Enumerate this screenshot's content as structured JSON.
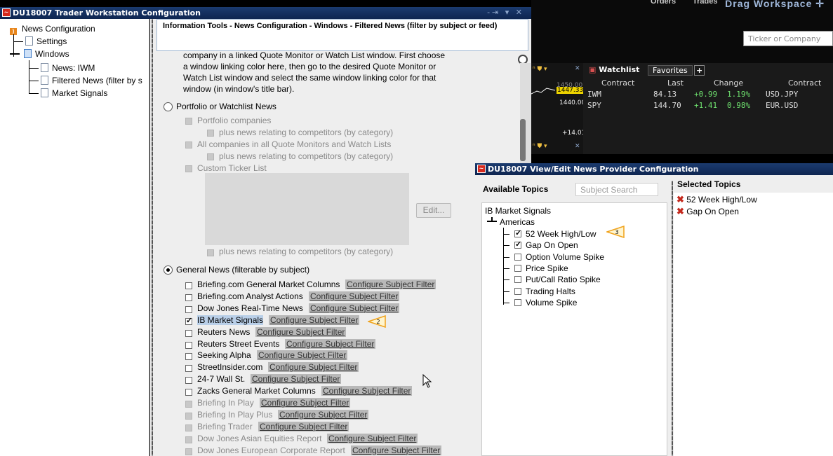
{
  "workspace": {
    "tabs": [
      "Orders",
      "Trades"
    ],
    "drag_label": "Drag Workspace",
    "ticker_placeholder": "Ticker or Company"
  },
  "config_window": {
    "title": "DU18007 Trader Workstation Configuration",
    "controls": "-⇥ ▾  ✕",
    "tree": {
      "root": "News Configuration",
      "settings": "Settings",
      "windows": "Windows",
      "items": [
        "News: IWM",
        "Filtered News (filter by s",
        "Market Signals"
      ]
    },
    "info_header": "Information Tools - News Configuration - Windows - Filtered News (filter by subject or feed)",
    "intro_lines": [
      "company in a linked Quote Monitor or Watch List window. First choose",
      "a window linking color here, then go to the desired Quote Monitor or",
      "Watch List window and select the same window linking color for that",
      "window (in window's title bar)."
    ],
    "portfolio_radio": "Portfolio or Watchlist News",
    "portfolio_opts": [
      "Portfolio companies",
      "plus news relating to competitors (by category)",
      "All companies in all Quote Monitors and Watch Lists",
      "plus news relating to competitors (by category)",
      "Custom Ticker List"
    ],
    "edit_button": "Edit...",
    "custom_competitors": "plus news relating to competitors (by category)",
    "general_radio": "General News (filterable by subject)",
    "configure_link": "Configure Subject Filter",
    "sources": [
      {
        "name": "Briefing.com General Market Columns",
        "checked": false,
        "enabled": true
      },
      {
        "name": "Briefing.com Analyst Actions",
        "checked": false,
        "enabled": true
      },
      {
        "name": "Dow Jones Real-Time News",
        "checked": false,
        "enabled": true
      },
      {
        "name": "IB Market Signals",
        "checked": true,
        "enabled": true
      },
      {
        "name": "Reuters News",
        "checked": false,
        "enabled": true
      },
      {
        "name": "Reuters Street Events",
        "checked": false,
        "enabled": true
      },
      {
        "name": "Seeking Alpha",
        "checked": false,
        "enabled": true
      },
      {
        "name": "StreetInsider.com",
        "checked": false,
        "enabled": true
      },
      {
        "name": "24-7 Wall St.",
        "checked": false,
        "enabled": true
      },
      {
        "name": "Zacks General Market Columns",
        "checked": false,
        "enabled": true
      },
      {
        "name": "Briefing In Play",
        "checked": false,
        "enabled": false
      },
      {
        "name": "Briefing In Play Plus",
        "checked": false,
        "enabled": false
      },
      {
        "name": "Briefing Trader",
        "checked": false,
        "enabled": false
      },
      {
        "name": "Dow Jones Asian Equities Report",
        "checked": false,
        "enabled": false
      },
      {
        "name": "Dow Jones European Corporate Report",
        "checked": false,
        "enabled": false
      }
    ],
    "callouts": [
      "1",
      "2",
      "3"
    ]
  },
  "mini_chart": {
    "price_high": "1447.33",
    "price_top": "1450.00",
    "price_mid": "1440.00",
    "change": "+14.01"
  },
  "watchlist": {
    "title": "Watchlist",
    "tab": "Favorites",
    "add_tab": "+",
    "columns": [
      "Contract",
      "Last",
      "Change",
      "Contract"
    ],
    "rows": [
      {
        "contract": "IWM",
        "last": "84.13",
        "change": "+0.99",
        "pct": "1.19%",
        "fx": "USD.JPY"
      },
      {
        "contract": "SPY",
        "last": "144.70",
        "change": "+1.41",
        "pct": "0.98%",
        "fx": "EUR.USD"
      }
    ]
  },
  "news_provider": {
    "title": "DU18007 View/Edit News Provider Configuration",
    "available_label": "Available Topics",
    "search_placeholder": "Subject Search",
    "selected_label": "Selected Topics",
    "selected": [
      "52 Week High/Low",
      "Gap On Open"
    ],
    "provider": "IB Market Signals",
    "region": "Americas",
    "topics": [
      {
        "name": "52 Week High/Low",
        "checked": true
      },
      {
        "name": "Gap On Open",
        "checked": true
      },
      {
        "name": "Option Volume Spike",
        "checked": false
      },
      {
        "name": "Price Spike",
        "checked": false
      },
      {
        "name": "Put/Call Ratio Spike",
        "checked": false
      },
      {
        "name": "Trading Halts",
        "checked": false
      },
      {
        "name": "Volume Spike",
        "checked": false
      }
    ]
  }
}
